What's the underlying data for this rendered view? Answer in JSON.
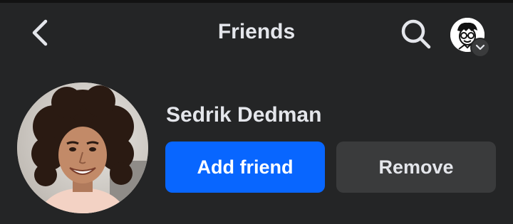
{
  "header": {
    "title": "Friends",
    "back_icon": "chevron-left-icon",
    "search_icon": "search-icon",
    "account_icon": "profile-avatar",
    "account_chevron_icon": "chevron-down-icon"
  },
  "friend": {
    "name": "Sedrik Dedman",
    "add_label": "Add friend",
    "remove_label": "Remove"
  },
  "colors": {
    "background": "#242526",
    "primary": "#0866ff",
    "secondary_button": "#3a3b3c",
    "text": "#e4e6eb"
  }
}
